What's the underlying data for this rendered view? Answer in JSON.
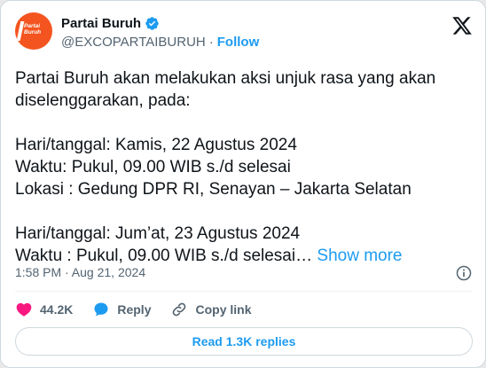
{
  "author": {
    "display_name": "Partai Buruh",
    "handle": "@EXCOPARTAIBURUH",
    "separator": "·",
    "follow_label": "Follow",
    "avatar_text": "Partai Buruh",
    "verified_color": "#1d9bf0",
    "avatar_color": "#f4541f"
  },
  "tweet": {
    "text_lines": [
      "Partai Buruh akan melakukan aksi unjuk rasa yang akan",
      "diselenggarakan, pada:",
      "",
      "Hari/tanggal: Kamis, 22 Agustus 2024",
      "Waktu: Pukul, 09.00 WIB s./d selesai",
      "Lokasi : Gedung DPR RI, Senayan – Jakarta Selatan",
      "",
      "Hari/tanggal: Jum’at, 23 Agustus 2024",
      "Waktu : Pukul, 09.00 WIB s./d selesai… "
    ],
    "show_more": "Show more",
    "timestamp": "1:58 PM · Aug 21, 2024"
  },
  "actions": {
    "likes_count": "44.2K",
    "reply_label": "Reply",
    "copy_link_label": "Copy link",
    "like_color": "#f91880",
    "reply_color": "#1d9bf0"
  },
  "replies_button": "Read 1.3K replies",
  "icons": [
    "verified-badge-icon",
    "x-logo-icon",
    "info-icon",
    "heart-icon",
    "reply-bubble-icon",
    "link-icon"
  ]
}
